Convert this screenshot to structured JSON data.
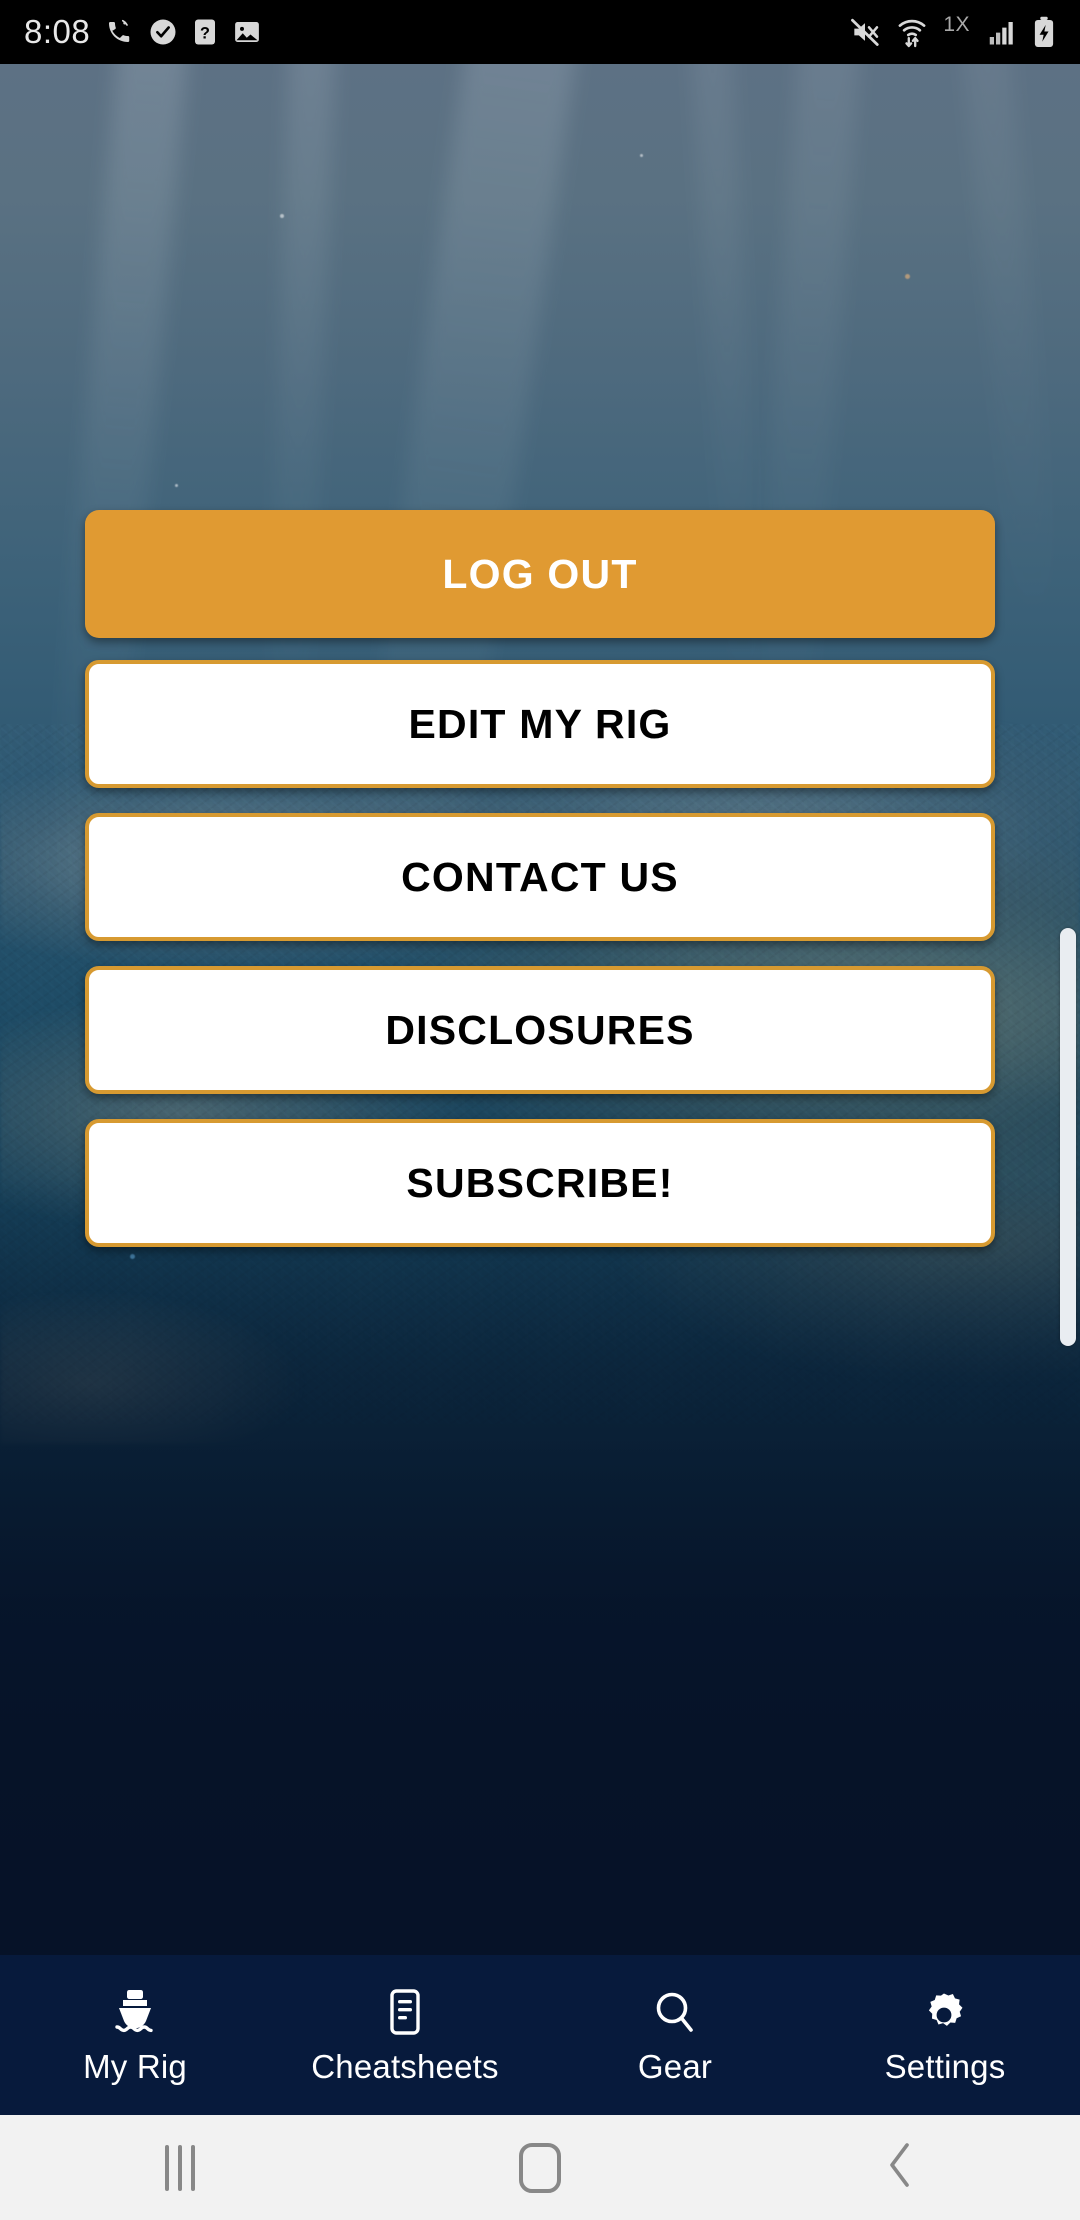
{
  "status_bar": {
    "time": "8:08",
    "left_icons": [
      "wifi-calling-icon",
      "verified-shield-icon",
      "unknown-sim-icon",
      "image-icon"
    ],
    "right_icons": [
      "mute-icon",
      "wifi-transfer-icon",
      "network-1x-icon",
      "signal-bars-icon",
      "battery-charging-icon"
    ],
    "network_label": "1X"
  },
  "buttons": [
    {
      "label": "LOG OUT",
      "name": "log-out-button",
      "style": "primary"
    },
    {
      "label": "EDIT MY RIG",
      "name": "edit-my-rig-button",
      "style": "outline"
    },
    {
      "label": "CONTACT US",
      "name": "contact-us-button",
      "style": "outline"
    },
    {
      "label": "DISCLOSURES",
      "name": "disclosures-button",
      "style": "outline"
    },
    {
      "label": "SUBSCRIBE!",
      "name": "subscribe-button",
      "style": "outline"
    }
  ],
  "tab_bar": {
    "items": [
      {
        "label": "My Rig",
        "icon": "boat-icon"
      },
      {
        "label": "Cheatsheets",
        "icon": "document-icon"
      },
      {
        "label": "Gear",
        "icon": "search-icon"
      },
      {
        "label": "Settings",
        "icon": "gear-icon"
      }
    ]
  },
  "system_nav": {
    "recents": "recents-icon",
    "home": "home-icon",
    "back": "back-icon"
  },
  "colors": {
    "accent_orange": "#e09a32",
    "button_border": "#d79a31",
    "tabbar_navy": "#071a3c",
    "button_text_dark": "#000000",
    "button_text_light": "#ffffff",
    "system_nav_bg": "#f2f2f2"
  },
  "scrollbar": {
    "visible": true
  }
}
